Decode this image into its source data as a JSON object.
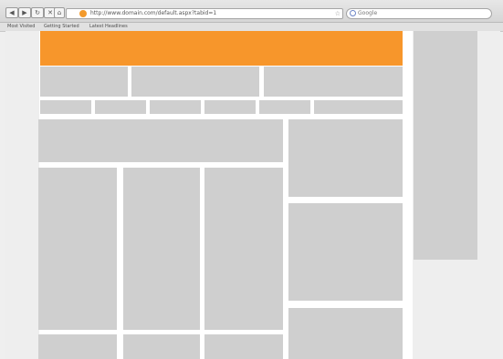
{
  "browser": {
    "toolbar_buttons": [
      "◀",
      "▶",
      "↻",
      "✕",
      "⌂"
    ],
    "address_url": "http://www.domain.com/default.aspx?tabid=1",
    "search_placeholder": "Google",
    "bookmarks": [
      "Most Visited",
      "Getting Started",
      "Latest Headlines"
    ]
  },
  "colors": {
    "header": "#f7962b",
    "placeholder_block": "#cfcfcf",
    "page_background": "#eeeeee",
    "content_background": "#ffffff"
  }
}
